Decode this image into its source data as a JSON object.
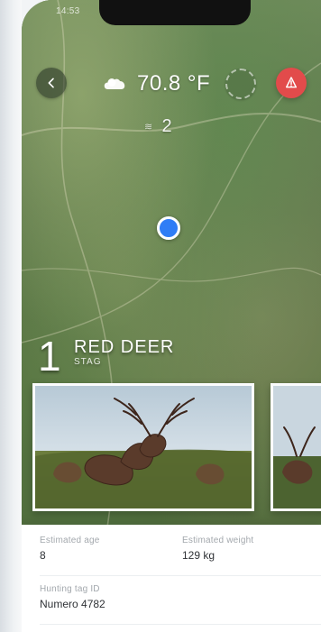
{
  "status_bar": {
    "time": "14:53"
  },
  "top_bar": {
    "weather_icon": "partly-cloudy-icon",
    "temperature": "70.8 °F",
    "wind_value": "2"
  },
  "species": {
    "count": "1",
    "name": "RED DEER",
    "sub": "STAG"
  },
  "details": {
    "estimated_age_label": "Estimated age",
    "estimated_age_value": "8",
    "estimated_weight_label": "Estimated weight",
    "estimated_weight_value": "129 kg",
    "hunting_tag_label": "Hunting tag ID",
    "hunting_tag_value": "Numero 4782"
  },
  "colors": {
    "accent_red": "#e24b4b",
    "location_blue": "#2f7df6"
  }
}
